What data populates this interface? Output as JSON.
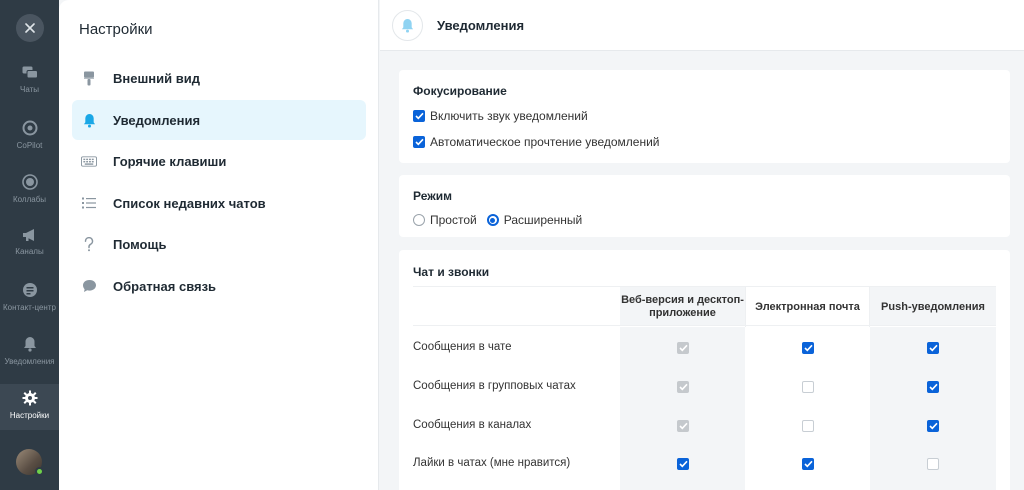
{
  "rail": {
    "items": [
      {
        "label": "Чаты",
        "icon": "chats-icon"
      },
      {
        "label": "CoPilot",
        "icon": "copilot-icon"
      },
      {
        "label": "Коллабы",
        "icon": "collabs-icon"
      },
      {
        "label": "Каналы",
        "icon": "megaphone-icon"
      },
      {
        "label": "Контакт-центр",
        "icon": "contact-center-icon"
      },
      {
        "label": "Уведомления",
        "icon": "bell-icon"
      },
      {
        "label": "Настройки",
        "icon": "gear-icon"
      }
    ]
  },
  "sidebar": {
    "title": "Настройки",
    "items": [
      {
        "label": "Внешний вид",
        "icon": "brush-icon"
      },
      {
        "label": "Уведомления",
        "icon": "bell-icon"
      },
      {
        "label": "Горячие клавиши",
        "icon": "keyboard-icon"
      },
      {
        "label": "Список недавних чатов",
        "icon": "list-icon"
      },
      {
        "label": "Помощь",
        "icon": "question-icon"
      },
      {
        "label": "Обратная связь",
        "icon": "feedback-icon"
      }
    ]
  },
  "header": {
    "title": "Уведомления"
  },
  "focus": {
    "title": "Фокусирование",
    "options": [
      {
        "label": "Включить звук уведомлений",
        "checked": true
      },
      {
        "label": "Автоматическое прочтение уведомлений",
        "checked": true
      }
    ]
  },
  "mode": {
    "title": "Режим",
    "options": [
      {
        "label": "Простой",
        "selected": false
      },
      {
        "label": "Расширенный",
        "selected": true
      }
    ]
  },
  "chat_calls": {
    "title": "Чат и звонки",
    "columns": [
      "Веб-версия и десктоп-\nприложение",
      "Электронная почта",
      "Push-уведомления"
    ],
    "rows": [
      {
        "label": "Сообщения в чате",
        "states": [
          "disabled",
          "on",
          "on"
        ]
      },
      {
        "label": "Сообщения в групповых чатах",
        "states": [
          "disabled",
          "off",
          "on"
        ]
      },
      {
        "label": "Сообщения в каналах",
        "states": [
          "disabled",
          "off",
          "on"
        ]
      },
      {
        "label": "Лайки в чатах (мне нравится)",
        "states": [
          "on",
          "on",
          "off"
        ]
      }
    ]
  },
  "colors": {
    "accent": "#0a63d9",
    "rail": "#2f3b45",
    "active_bg": "#e6f6fd"
  }
}
